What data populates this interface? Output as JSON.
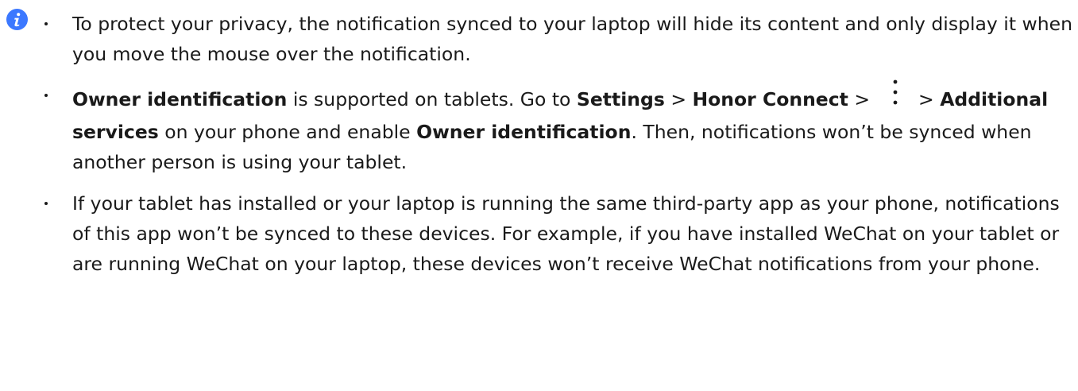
{
  "notes": [
    {
      "text": "To protect your privacy, the notification synced to your laptop will hide its content and only display it when you move the mouse over the notification."
    },
    {
      "owner_identification": "Owner identification",
      "supported_text": " is supported on tablets. Go to ",
      "settings": "Settings",
      "sep1": " > ",
      "honor_connect": "Honor Connect",
      "sep2": " > ",
      "sep3": " > ",
      "additional_services": "Additional services",
      "phone_enable": " on your phone and enable ",
      "owner_identification_2": "Owner identification",
      "tail": ". Then, notifications won’t be synced when another person is using your tablet."
    },
    {
      "text": "If your tablet has installed or your laptop is running the same third-party app as your phone, notifications of this app won’t be synced to these devices. For example, if you have installed WeChat on your tablet or are running WeChat on your laptop, these devices won’t receive WeChat notifications from your phone."
    }
  ],
  "icons": {
    "info": "info-icon",
    "more": "more-vertical-icon"
  },
  "colors": {
    "info_icon": "#3b78ff",
    "text": "#1a1a1a"
  }
}
